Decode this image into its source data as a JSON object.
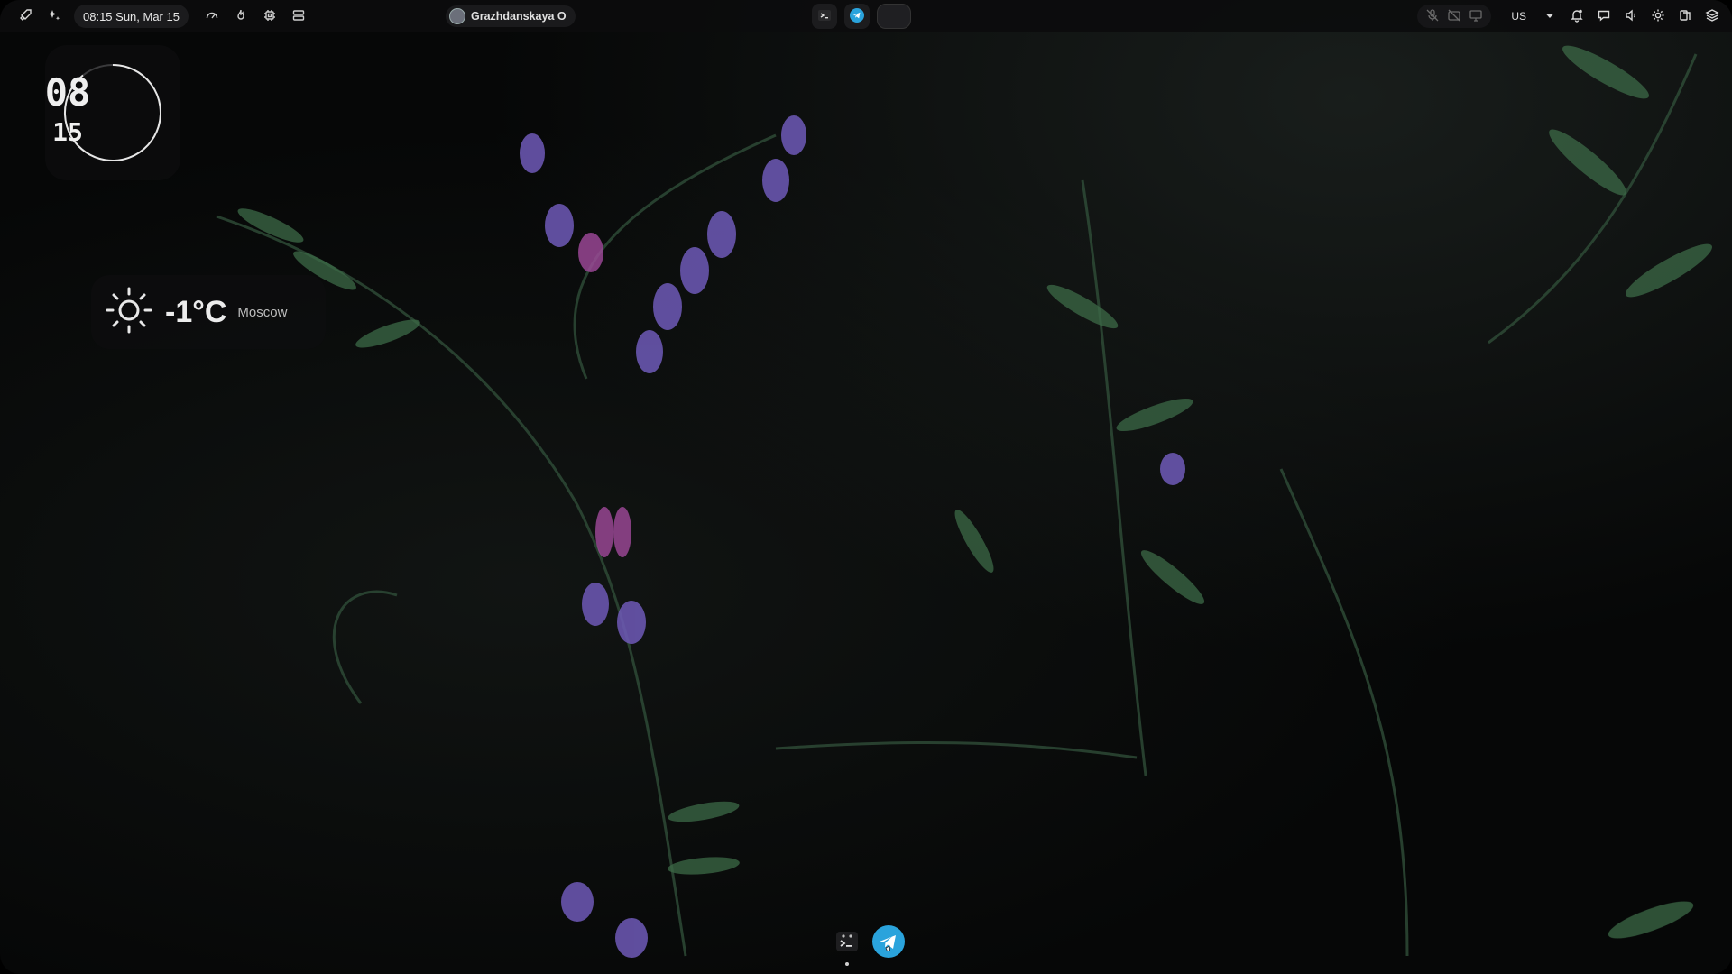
{
  "topbar": {
    "datetime": "08:15 Sun, Mar 15",
    "media_title": "Grazhdanskaya O",
    "keyboard_layout": "US"
  },
  "clock_widget": {
    "hours": "08",
    "minutes": "15"
  },
  "weather_widget": {
    "temperature": "-1°C",
    "city": "Moscow",
    "icon": "sun-icon"
  },
  "dock": {
    "items": [
      {
        "name": "terminal",
        "icon": "terminal-icon",
        "running": true
      },
      {
        "name": "telegram",
        "icon": "telegram-icon",
        "running": false
      }
    ]
  },
  "colors": {
    "telegram": "#2aa3dc",
    "bar": "#0c0c0d",
    "pill": "#1b1b1d"
  }
}
